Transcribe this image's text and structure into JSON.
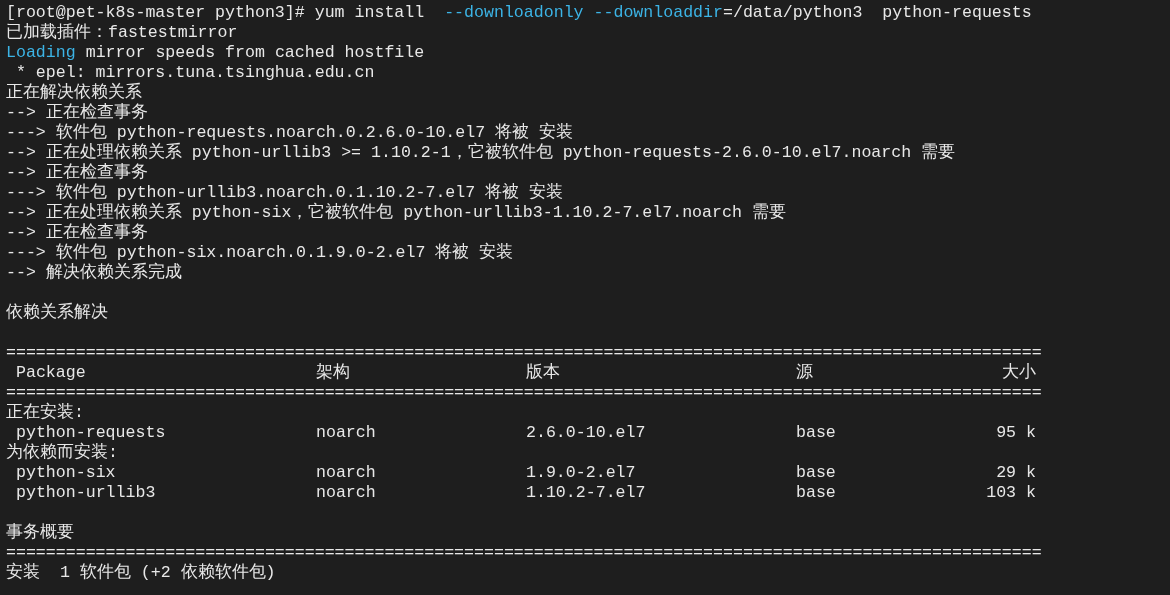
{
  "lines_before": [
    {
      "segments": [
        {
          "kind": "text",
          "text": "[root@pet-k8s-master python3]# yum install  "
        },
        {
          "kind": "option",
          "text": "--downloadonly --downloaddir"
        },
        {
          "kind": "text",
          "text": "=/data/python3  python-requests"
        }
      ]
    },
    {
      "segments": [
        {
          "kind": "text",
          "text": "已加载插件：fastestmirror"
        }
      ]
    },
    {
      "segments": [
        {
          "kind": "option",
          "text": "Loading"
        },
        {
          "kind": "text",
          "text": " mirror speeds from cached hostfile"
        }
      ]
    },
    {
      "segments": [
        {
          "kind": "text",
          "text": " * epel: mirrors.tuna.tsinghua.edu.cn"
        }
      ]
    },
    {
      "segments": [
        {
          "kind": "text",
          "text": "正在解决依赖关系"
        }
      ]
    },
    {
      "segments": [
        {
          "kind": "text",
          "text": "--> 正在检查事务"
        }
      ]
    },
    {
      "segments": [
        {
          "kind": "text",
          "text": "---> 软件包 python-requests.noarch.0.2.6.0-10.el7 将被 安装"
        }
      ]
    },
    {
      "segments": [
        {
          "kind": "text",
          "text": "--> 正在处理依赖关系 python-urllib3 >= 1.10.2-1，它被软件包 python-requests-2.6.0-10.el7.noarch 需要"
        }
      ]
    },
    {
      "segments": [
        {
          "kind": "text",
          "text": "--> 正在检查事务"
        }
      ]
    },
    {
      "segments": [
        {
          "kind": "text",
          "text": "---> 软件包 python-urllib3.noarch.0.1.10.2-7.el7 将被 安装"
        }
      ]
    },
    {
      "segments": [
        {
          "kind": "text",
          "text": "--> 正在处理依赖关系 python-six，它被软件包 python-urllib3-1.10.2-7.el7.noarch 需要"
        }
      ]
    },
    {
      "segments": [
        {
          "kind": "text",
          "text": "--> 正在检查事务"
        }
      ]
    },
    {
      "segments": [
        {
          "kind": "text",
          "text": "---> 软件包 python-six.noarch.0.1.9.0-2.el7 将被 安装"
        }
      ]
    },
    {
      "segments": [
        {
          "kind": "text",
          "text": "--> 解决依赖关系完成"
        }
      ]
    },
    {
      "kind": "blank"
    },
    {
      "segments": [
        {
          "kind": "text",
          "text": "依赖关系解决"
        }
      ]
    },
    {
      "kind": "blank"
    }
  ],
  "table": {
    "separator": "========================================================================================================",
    "columns": [
      "Package",
      "架构",
      "版本",
      "源",
      "大小"
    ],
    "groups": [
      {
        "label": "正在安装:",
        "rows": [
          [
            "python-requests",
            "noarch",
            "2.6.0-10.el7",
            "base",
            "95 k"
          ]
        ]
      },
      {
        "label": "为依赖而安装:",
        "rows": [
          [
            "python-six",
            "noarch",
            "1.9.0-2.el7",
            "base",
            "29 k"
          ],
          [
            "python-urllib3",
            "noarch",
            "1.10.2-7.el7",
            "base",
            "103 k"
          ]
        ]
      }
    ]
  },
  "summary": {
    "title": "事务概要",
    "separator": "========================================================================================================",
    "text": "安装  1 软件包 (+2 依赖软件包)"
  }
}
